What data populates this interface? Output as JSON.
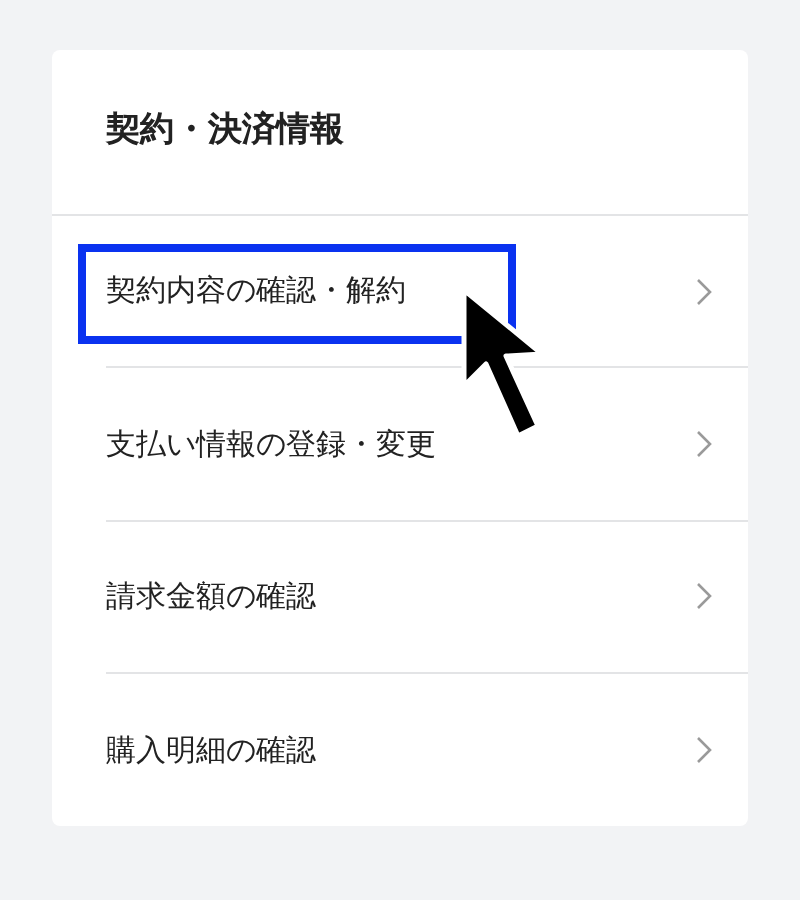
{
  "card": {
    "title": "契約・決済情報",
    "items": [
      {
        "label": "契約内容の確認・解約",
        "highlighted": true
      },
      {
        "label": "支払い情報の登録・変更",
        "highlighted": false
      },
      {
        "label": "請求金額の確認",
        "highlighted": false
      },
      {
        "label": "購入明細の確認",
        "highlighted": false
      }
    ]
  }
}
